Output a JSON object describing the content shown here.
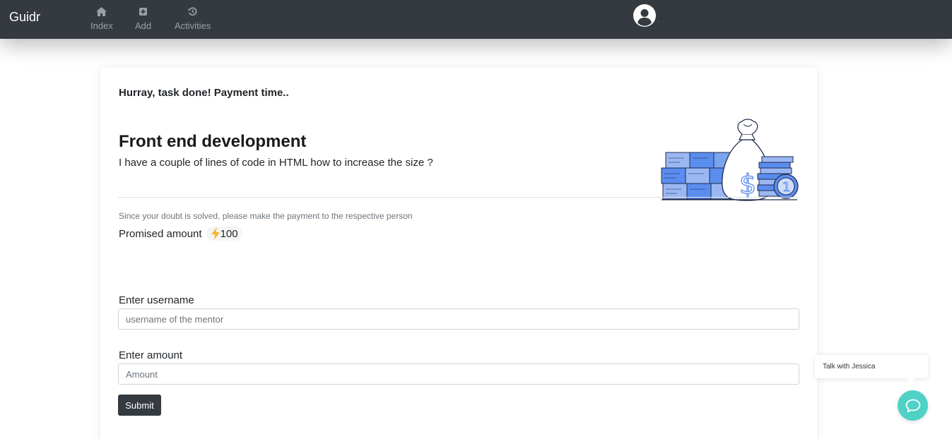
{
  "navbar": {
    "brand": "Guidr",
    "items": [
      {
        "label": "Index",
        "icon": "home-icon"
      },
      {
        "label": "Add",
        "icon": "plus-square-icon"
      },
      {
        "label": "Activities",
        "icon": "history-icon"
      }
    ],
    "avatar_icon": "user-circle-icon"
  },
  "card": {
    "heading": "Hurray, task done! Payment time..",
    "task_title": "Front end development",
    "task_description": "I have a couple of lines of code in HTML how to increase the size ?",
    "illustration_icon": "money-bag-icon",
    "note": "Since your doubt is solved, please make the payment to the respective person",
    "promised_label": "Promised amount",
    "promised_amount": "100",
    "promised_icon": "lightning-icon"
  },
  "form": {
    "username_label": "Enter username",
    "username_placeholder": "username of the mentor",
    "amount_label": "Enter amount",
    "amount_placeholder": "Amount",
    "submit_label": "Submit"
  },
  "chat": {
    "bubble_text": "Talk with Jessica",
    "button_icon": "chat-icon",
    "accent": "#4fd1c5"
  },
  "colors": {
    "navbar_bg": "#343a40",
    "button_bg": "#343a40",
    "illustration_blue": "#5b8def"
  }
}
